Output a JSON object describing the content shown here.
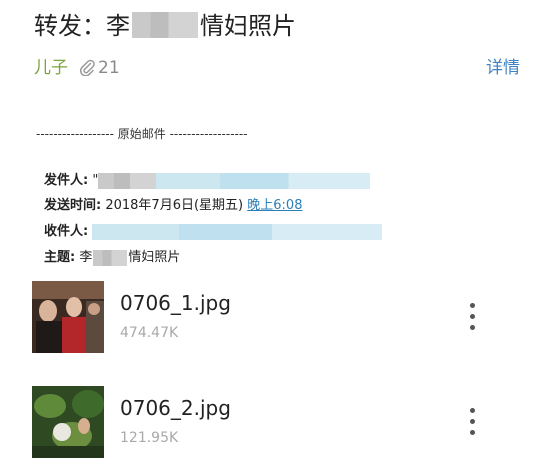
{
  "subject_title": {
    "prefix": "转发：李",
    "suffix": "情妇照片"
  },
  "meta": {
    "sender_short": "儿子",
    "attachment_count": "21",
    "details_link": "详情"
  },
  "original_separator": "------------------ 原始邮件 ------------------",
  "header": {
    "from_label": "发件人:",
    "from_value_prefix": "\"",
    "date_label": "发送时间:",
    "date_value": "2018年7月6日(星期五)",
    "date_time_link": "晚上6:08",
    "to_label": "收件人:",
    "subject_label": "主题:",
    "subject_prefix": "李",
    "subject_suffix": "情妇照片"
  },
  "attachments": [
    {
      "filename": "0706_1.jpg",
      "size": "474.47K"
    },
    {
      "filename": "0706_2.jpg",
      "size": "121.95K"
    }
  ],
  "colors": {
    "link": "#3f83c5",
    "sender": "#7aa53a",
    "muted": "#a9a9a9"
  },
  "icons": {
    "attachment": "paperclip-icon",
    "more": "more-vertical-icon"
  }
}
